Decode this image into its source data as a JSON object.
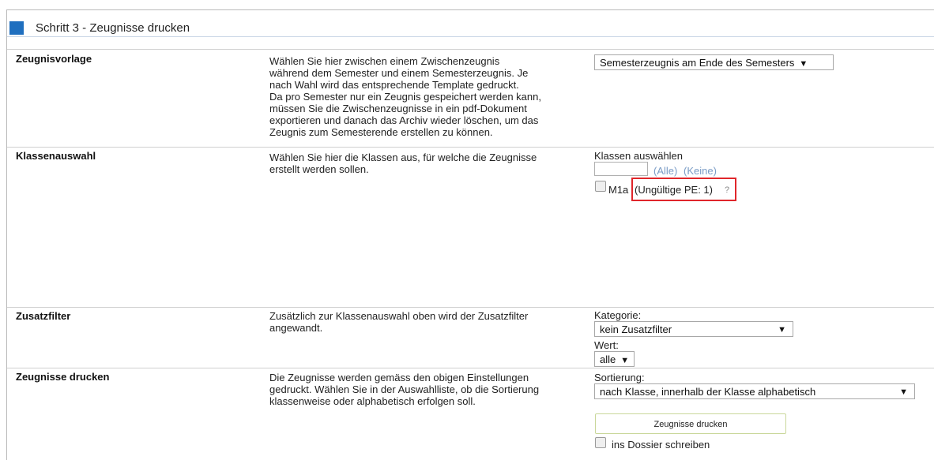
{
  "header": {
    "title": "Schritt 3 - Zeugnisse drucken"
  },
  "rows": {
    "vorlage": {
      "label": "Zeugnisvorlage",
      "desc_lines": [
        "Wählen Sie hier zwischen einem Zwischenzeugnis",
        "während dem Semester und einem Semesterzeugnis. Je",
        "nach Wahl wird das entsprechende Template gedruckt.",
        "Da pro Semester nur ein Zeugnis gespeichert werden kann,",
        "müssen Sie die Zwischenzeugnisse in ein pdf-Dokument",
        "exportieren und danach das Archiv wieder löschen, um das",
        "Zeugnis zum Semesterende erstellen zu können."
      ],
      "select_value": "Semesterzeugnis am Ende des Semesters"
    },
    "klassen": {
      "label": "Klassenauswahl",
      "desc_lines": [
        "Wählen Sie hier die Klassen aus, für welche die Zeugnisse",
        "erstellt werden sollen."
      ],
      "heading": "Klassen auswählen",
      "filter_value": "",
      "all_link": "(Alle)",
      "none_link": "(Keine)",
      "class_name": "M1a",
      "invalid_note": "(Ungültige PE: 1)",
      "help_mark": "?"
    },
    "zusatz": {
      "label": "Zusatzfilter",
      "desc_lines": [
        "Zusätzlich zur Klassenauswahl oben wird der Zusatzfilter",
        "angewandt."
      ],
      "kategorie_label": "Kategorie:",
      "kategorie_value": "kein Zusatzfilter",
      "wert_label": "Wert:",
      "wert_value": "alle"
    },
    "drucken": {
      "label": "Zeugnisse drucken",
      "desc_lines": [
        "Die Zeugnisse werden gemäss den obigen Einstellungen",
        "gedruckt. Wählen Sie in der Auswahlliste, ob die Sortierung",
        "klassenweise oder alphabetisch erfolgen soll."
      ],
      "sortierung_label": "Sortierung:",
      "sortierung_value": "nach Klasse, innerhalb der Klasse alphabetisch",
      "button_label": "Zeugnisse drucken",
      "dossier_label": "ins Dossier schreiben"
    }
  },
  "icons": {
    "dropdown": "▼"
  },
  "colors": {
    "accent": "#1f6fbf",
    "highlight": "#e0262b",
    "link": "#7a9cc6"
  }
}
